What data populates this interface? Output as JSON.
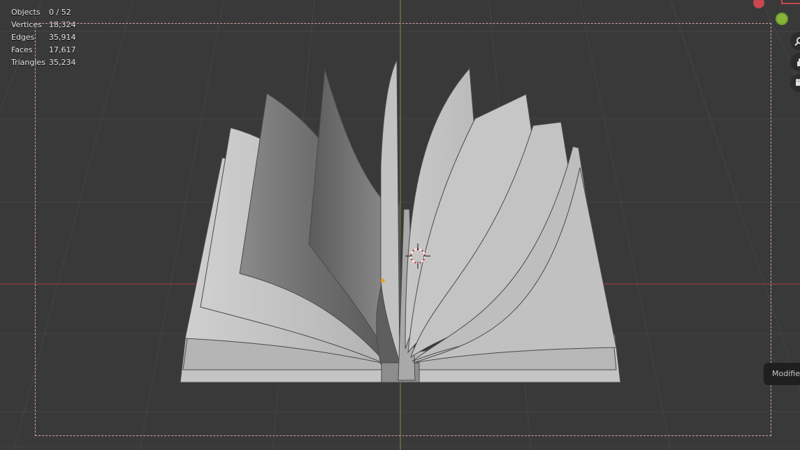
{
  "stats": [
    {
      "label": "Objects",
      "value": "0 / 52"
    },
    {
      "label": "Vertices",
      "value": "18,324"
    },
    {
      "label": "Edges",
      "value": "35,914"
    },
    {
      "label": "Faces",
      "value": "17,617"
    },
    {
      "label": "Triangles",
      "value": "35,234"
    }
  ],
  "sidebar": {
    "modifiers_tab": "Modifiers"
  },
  "navigation": {
    "zoom_icon": "zoom-icon",
    "pan_icon": "hand-pan-icon",
    "camera_icon": "camera-icon"
  },
  "colors": {
    "background": "#393939",
    "grid": "#454545",
    "x_axis": "#a83a3e",
    "y_axis": "#6f9a2f",
    "camera_frame": "#d9a0a0",
    "page_fill": "#bfbfbf",
    "origin_point": "#f0a030"
  }
}
